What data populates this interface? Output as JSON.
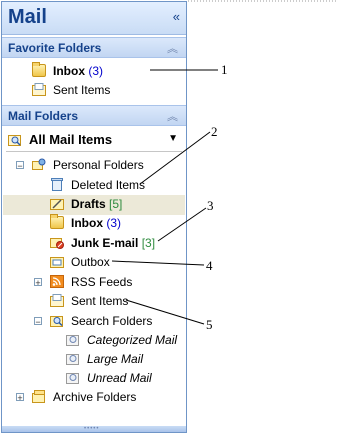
{
  "header": {
    "title": "Mail",
    "collapse_glyph": "«"
  },
  "favorites": {
    "title": "Favorite Folders",
    "chevron": "︽",
    "items": [
      {
        "label": "Inbox",
        "count": "(3)"
      },
      {
        "label": "Sent Items"
      }
    ]
  },
  "mail_folders": {
    "title": "Mail Folders",
    "chevron": "︽",
    "view_selector": {
      "label": "All Mail Items",
      "arrow": "▼"
    },
    "tree": {
      "root": "Personal Folders",
      "deleted": "Deleted Items",
      "drafts": {
        "label": "Drafts",
        "count": "[5]"
      },
      "inbox": {
        "label": "Inbox",
        "count": "(3)"
      },
      "junk": {
        "label": "Junk E-mail",
        "count": "[3]"
      },
      "outbox": "Outbox",
      "rss": "RSS Feeds",
      "sent": "Sent Items",
      "search_folders": "Search Folders",
      "categorized": "Categorized Mail",
      "large": "Large Mail",
      "unread": "Unread Mail",
      "archive": "Archive Folders"
    }
  },
  "callouts": {
    "c1": "1",
    "c2": "2",
    "c3": "3",
    "c4": "4",
    "c5": "5"
  },
  "expand": {
    "minus": "−",
    "plus": "+"
  },
  "grip": "•••••"
}
